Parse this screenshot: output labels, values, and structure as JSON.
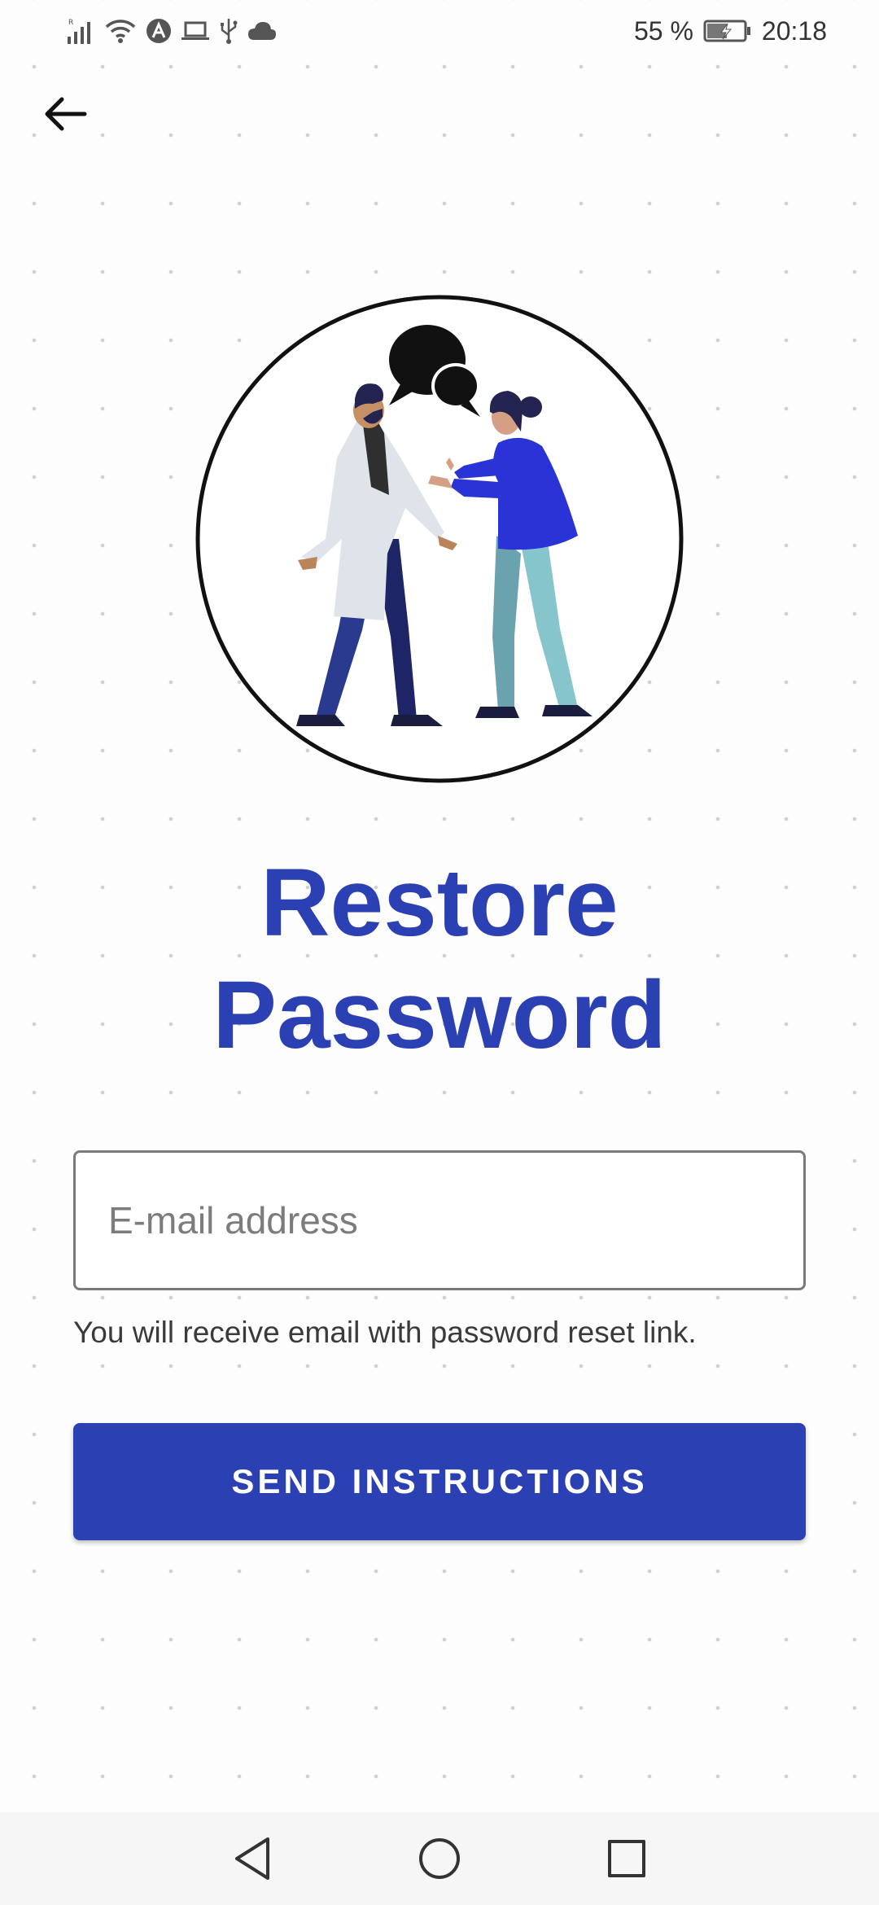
{
  "status_bar": {
    "battery_percent": "55 %",
    "time": "20:18",
    "battery_level": 0.55,
    "left_icons": [
      "signal-icon",
      "wifi-icon",
      "app-notification-icon",
      "laptop-icon",
      "usb-icon",
      "cloud-icon"
    ]
  },
  "header": {
    "back_icon": "arrow-left-icon"
  },
  "page": {
    "title_line1": "Restore",
    "title_line2": "Password",
    "email_placeholder": "E-mail address",
    "email_value": "",
    "helper_text": "You will receive email with password reset link.",
    "send_button_label": "SEND INSTRUCTIONS"
  },
  "nav_bar": {
    "icons": [
      "back-triangle-icon",
      "home-circle-icon",
      "recents-square-icon"
    ]
  },
  "colors": {
    "accent": "#2a40b3",
    "background": "#fdfdfd",
    "input_border": "#7a7a7a",
    "nav_background": "#f6f6f6"
  }
}
